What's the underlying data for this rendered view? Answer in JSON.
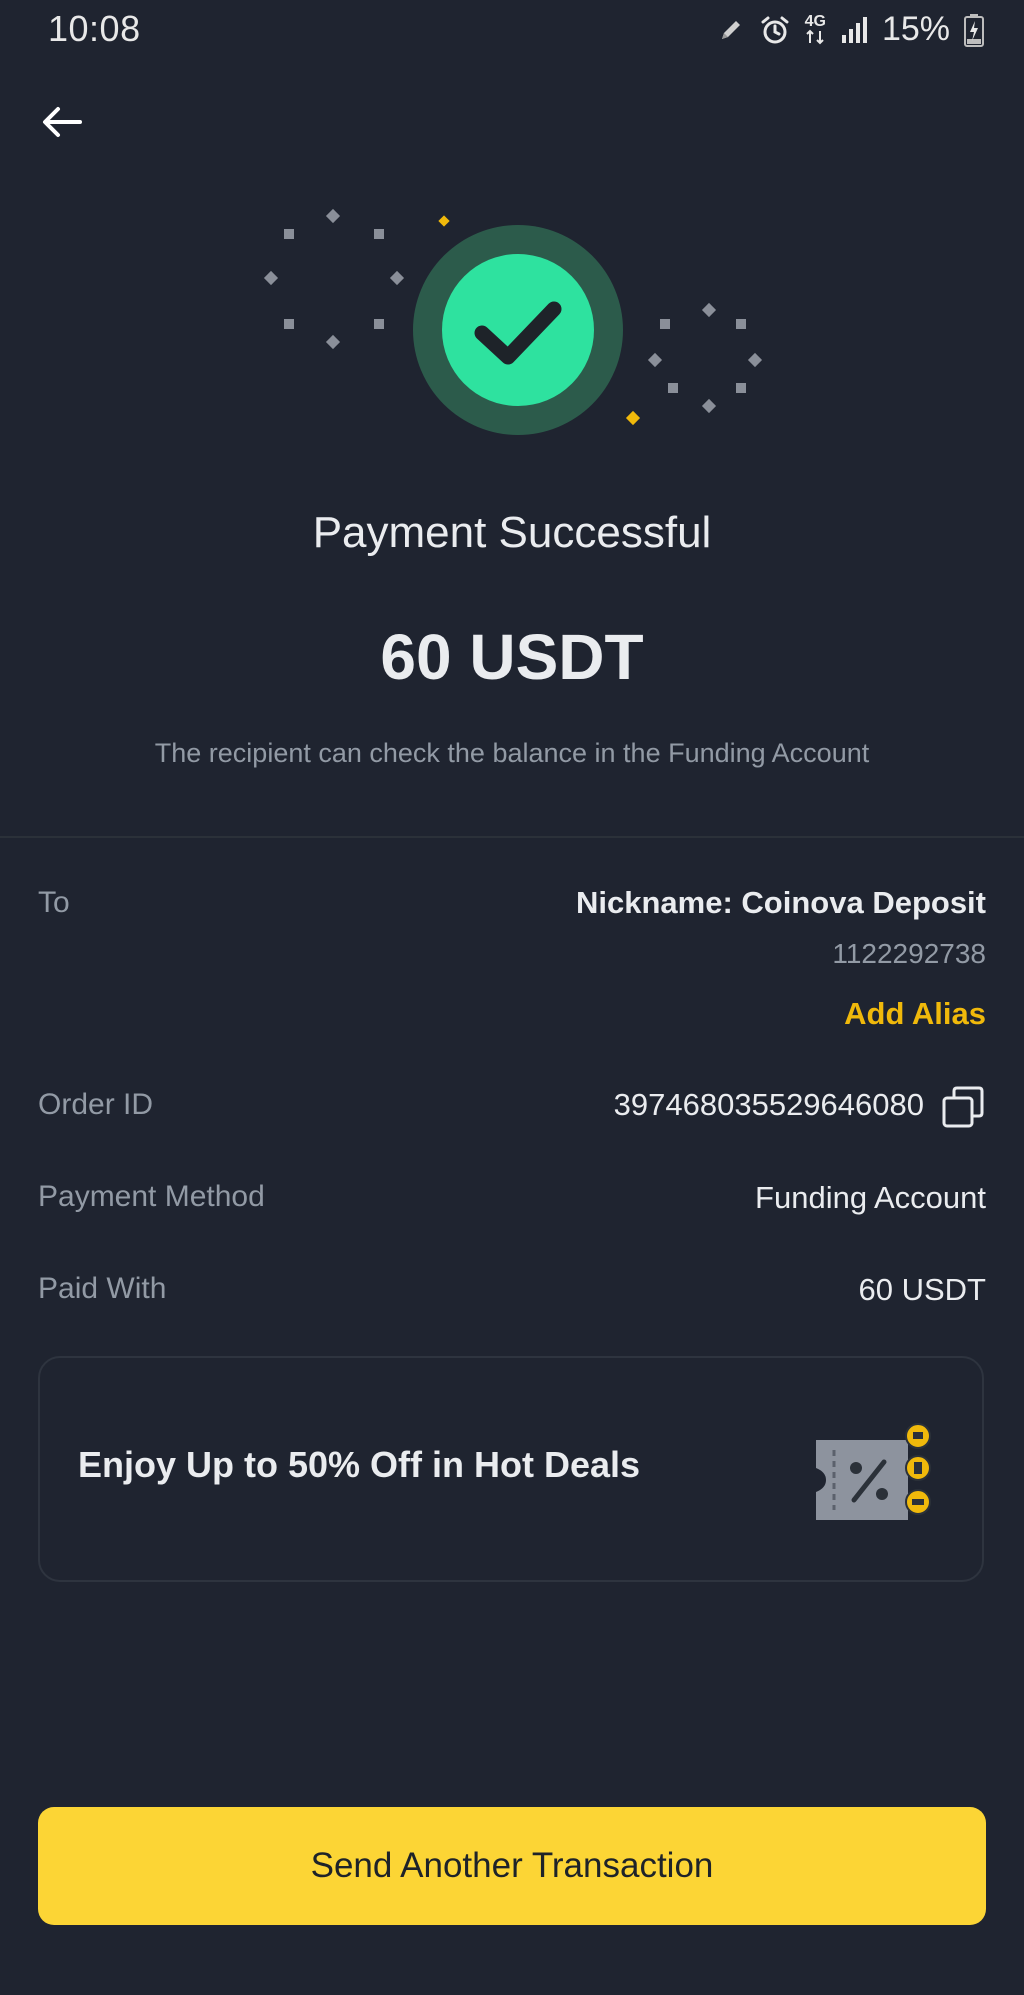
{
  "status_bar": {
    "time": "10:08",
    "network": "4G",
    "battery": "15%",
    "icons": [
      "pen-icon",
      "alarm-icon",
      "network-4g-icon",
      "signal-icon",
      "battery-charging-icon"
    ]
  },
  "header": {
    "back_icon": "arrow-left-icon"
  },
  "result": {
    "title": "Payment Successful",
    "amount": "60 USDT",
    "subtitle": "The recipient can check the balance in the Funding Account",
    "icon": "check-circle-icon"
  },
  "details": {
    "to_label": "To",
    "to_name": "Nickname: Coinova Deposit",
    "to_id": "1122292738",
    "add_alias": "Add Alias",
    "order_label": "Order ID",
    "order_value": "397468035529646080",
    "method_label": "Payment Method",
    "method_value": "Funding Account",
    "paid_label": "Paid With",
    "paid_value": "60 USDT"
  },
  "promo": {
    "text": "Enjoy Up to 50% Off in Hot Deals",
    "icon": "coupon-percent-icon"
  },
  "action": {
    "button_label": "Send Another Transaction"
  },
  "colors": {
    "background": "#1f2430",
    "success": "#2ee29f",
    "accent": "#f0b90b",
    "button": "#fcd535",
    "muted_text": "#929aa5"
  }
}
